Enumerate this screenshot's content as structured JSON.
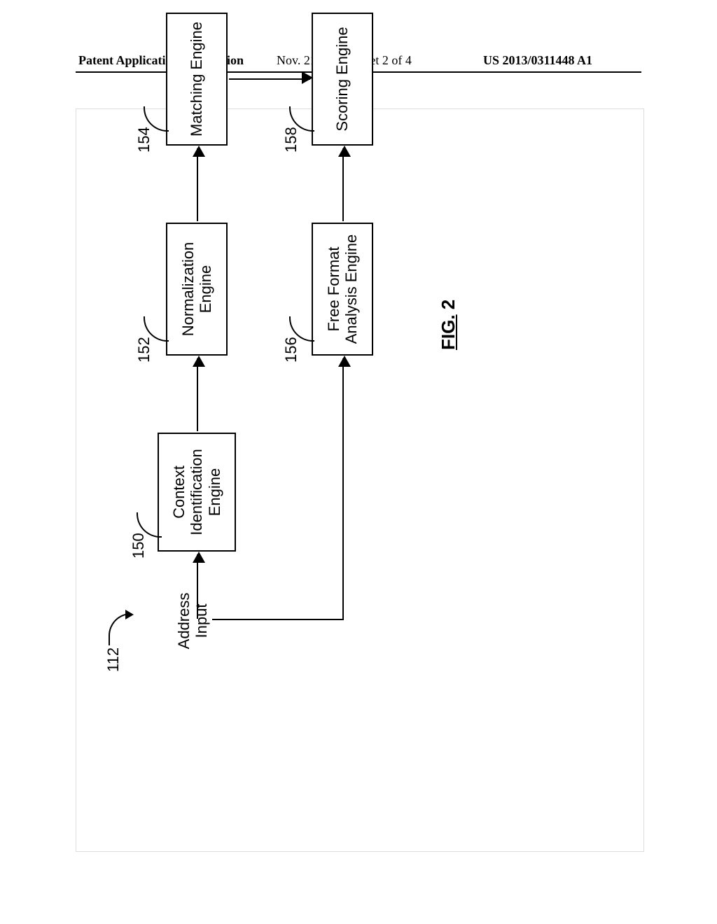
{
  "header": {
    "left": "Patent Application Publication",
    "center": "Nov. 21, 2013  Sheet 2 of 4",
    "right": "US 2013/0311448 A1"
  },
  "figure": {
    "caption_prefix": "FIG.",
    "caption_num": " 2",
    "system_ref": "112",
    "input_label": "Address\nInput",
    "blocks": {
      "context": {
        "ref": "150",
        "label": "Context\nIdentification\nEngine"
      },
      "normalize": {
        "ref": "152",
        "label": "Normalization\nEngine"
      },
      "matching": {
        "ref": "154",
        "label": "Matching Engine"
      },
      "free": {
        "ref": "156",
        "label": "Free Format\nAnalysis Engine"
      },
      "scoring": {
        "ref": "158",
        "label": "Scoring Engine"
      }
    }
  }
}
